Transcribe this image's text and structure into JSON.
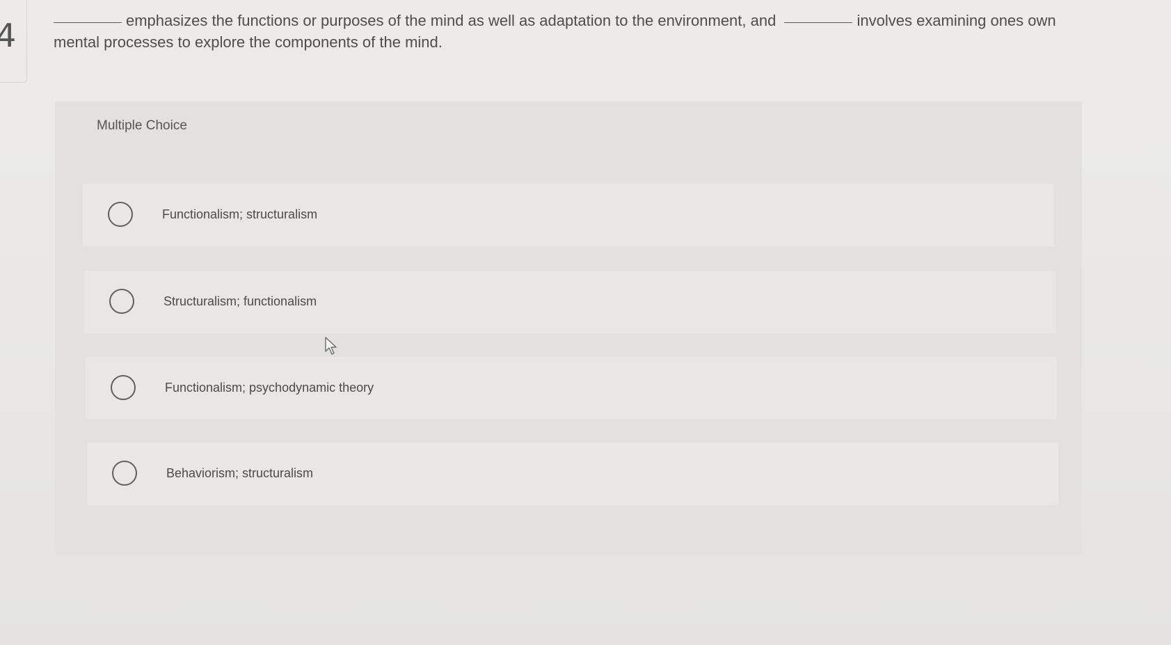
{
  "sidebar": {
    "question_number": "4"
  },
  "question": {
    "part1": "emphasizes the functions or purposes of the mind as well as adaptation to the environment, and",
    "part2": "involves examining ones own mental processes to explore the components of the mind."
  },
  "multiple_choice": {
    "label": "Multiple Choice",
    "options": [
      {
        "label": "Functionalism; structuralism",
        "selected": false
      },
      {
        "label": "Structuralism; functionalism",
        "selected": false
      },
      {
        "label": "Functionalism; psychodynamic theory",
        "selected": false
      },
      {
        "label": "Behaviorism; structuralism",
        "selected": false
      }
    ]
  },
  "icons": {
    "cursor": "mouse-pointer-icon",
    "radio": "radio-circle-icon"
  },
  "colors": {
    "background": "#ebeae7",
    "card": "#e2e1de",
    "option_row": "#e8e7e4",
    "text": "#4a4a4a"
  }
}
